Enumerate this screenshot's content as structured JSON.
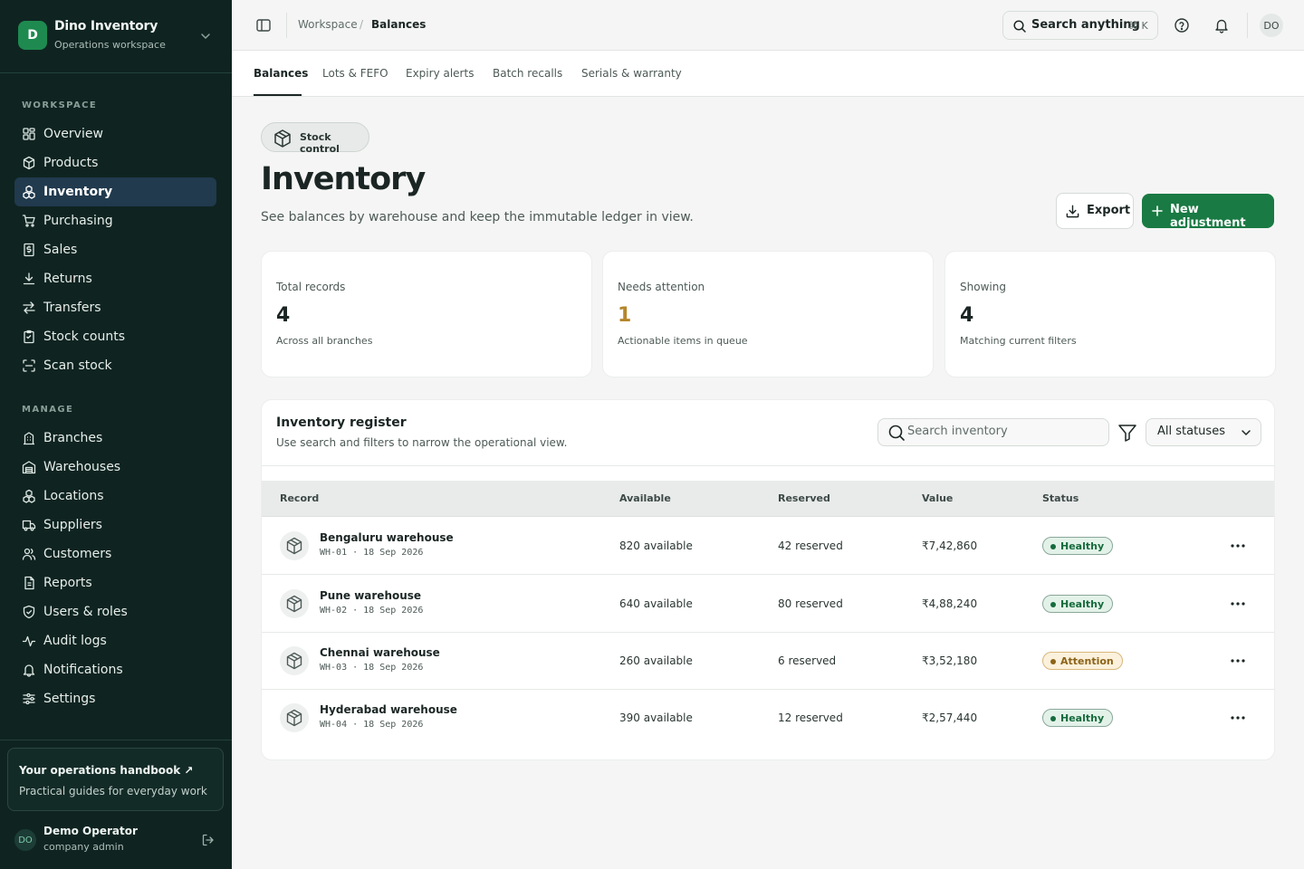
{
  "app": {
    "name": "Dino Inventory",
    "logo_letter": "D",
    "workspace": "Operations workspace",
    "brand_color": "#1e8a50"
  },
  "sidebar": {
    "section_workspace": "WORKSPACE",
    "workspace_items": [
      {
        "label": "Overview",
        "icon": "dashboard-icon"
      },
      {
        "label": "Products",
        "icon": "box-icon"
      },
      {
        "label": "Inventory",
        "icon": "stacked-boxes-icon",
        "active": true
      },
      {
        "label": "Purchasing",
        "icon": "cart-icon"
      },
      {
        "label": "Sales",
        "icon": "receipt-icon"
      },
      {
        "label": "Returns",
        "icon": "return-arrow-icon"
      },
      {
        "label": "Transfers",
        "icon": "transfer-icon"
      },
      {
        "label": "Stock counts",
        "icon": "clipboard-icon"
      },
      {
        "label": "Scan stock",
        "icon": "scan-icon"
      }
    ],
    "section_manage": "MANAGE",
    "manage_items": [
      {
        "label": "Branches",
        "icon": "building-icon"
      },
      {
        "label": "Warehouses",
        "icon": "warehouse-icon"
      },
      {
        "label": "Locations",
        "icon": "locations-icon"
      },
      {
        "label": "Suppliers",
        "icon": "truck-icon"
      },
      {
        "label": "Customers",
        "icon": "users-icon"
      },
      {
        "label": "Reports",
        "icon": "reports-icon"
      },
      {
        "label": "Users & roles",
        "icon": "shield-icon"
      },
      {
        "label": "Audit logs",
        "icon": "activity-icon"
      },
      {
        "label": "Notifications",
        "icon": "bell-icon"
      },
      {
        "label": "Settings",
        "icon": "sliders-icon"
      }
    ],
    "handbook_title": "Your operations handbook ↗",
    "handbook_sub": "Practical guides for everyday work",
    "user_initials": "DO",
    "user_name": "Demo Operator",
    "user_role": "company admin"
  },
  "topbar": {
    "breadcrumb_root": "Workspace",
    "breadcrumb_sep": "/",
    "breadcrumb_current": "Balances",
    "search_label": "Search anything",
    "search_kbd": "⌘ K",
    "avatar_initials": "DO"
  },
  "tabs": [
    {
      "label": "Balances",
      "active": true
    },
    {
      "label": "Lots & FEFO"
    },
    {
      "label": "Expiry alerts"
    },
    {
      "label": "Batch recalls"
    },
    {
      "label": "Serials & warranty"
    }
  ],
  "page": {
    "chip": "Stock control",
    "title": "Inventory",
    "subtitle": "See balances by warehouse and keep the immutable ledger in view.",
    "export_label": "Export",
    "new_label": "New adjustment",
    "primary_color": "#197a43"
  },
  "stats": [
    {
      "label": "Total records",
      "value": "4",
      "hint": "Across all branches"
    },
    {
      "label": "Needs attention",
      "value": "1",
      "hint": "Actionable items in queue",
      "tone": "warn"
    },
    {
      "label": "Showing",
      "value": "4",
      "hint": "Matching current filters"
    }
  ],
  "register": {
    "title": "Inventory register",
    "subtitle": "Use search and filters to narrow the operational view.",
    "search_placeholder": "Search inventory",
    "status_filter": "All statuses",
    "columns": [
      "Record",
      "Available",
      "Reserved",
      "Value",
      "Status"
    ],
    "rows": [
      {
        "name": "Bengaluru warehouse",
        "meta": "WH-01 · 18 Sep 2026",
        "available": "820 available",
        "reserved": "42 reserved",
        "value": "₹7,42,860",
        "status": "Healthy",
        "tone": "ok"
      },
      {
        "name": "Pune warehouse",
        "meta": "WH-02 · 18 Sep 2026",
        "available": "640 available",
        "reserved": "80 reserved",
        "value": "₹4,88,240",
        "status": "Healthy",
        "tone": "ok"
      },
      {
        "name": "Chennai warehouse",
        "meta": "WH-03 · 18 Sep 2026",
        "available": "260 available",
        "reserved": "6 reserved",
        "value": "₹3,52,180",
        "status": "Attention",
        "tone": "warn"
      },
      {
        "name": "Hyderabad warehouse",
        "meta": "WH-04 · 18 Sep 2026",
        "available": "390 available",
        "reserved": "12 reserved",
        "value": "₹2,57,440",
        "status": "Healthy",
        "tone": "ok"
      }
    ]
  }
}
